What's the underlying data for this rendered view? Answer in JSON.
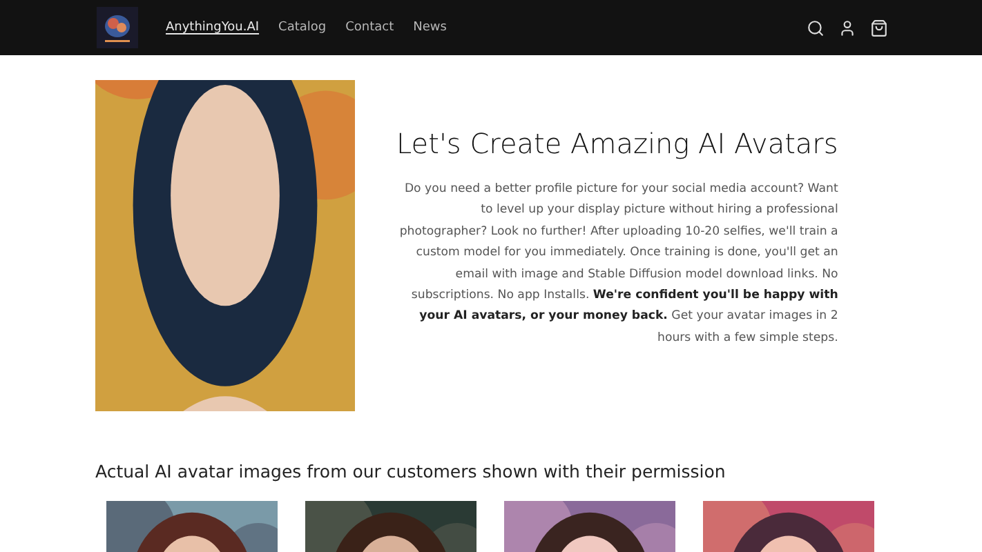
{
  "header": {
    "nav": [
      {
        "label": "AnythingYou.AI",
        "selected": true
      },
      {
        "label": "Catalog",
        "selected": false
      },
      {
        "label": "Contact",
        "selected": false
      },
      {
        "label": "News",
        "selected": false
      }
    ]
  },
  "hero": {
    "title": "Let's Create Amazing AI Avatars",
    "body": "Do you need a better profile picture for your social media account? Want to level up your display picture without hiring a professional photographer? Look no further! After uploading 10-20 selfies, we'll train a custom model for you immediately. Once training is done, you'll get an email with image and Stable Diffusion model download links. No subscriptions. No app Installs. **We're confident you'll be happy with your AI avatars, or your money back.** Get your avatar images in 2 hours with a few simple steps."
  },
  "gallery": {
    "heading": "Actual AI avatar images from our customers shown with their permission"
  }
}
